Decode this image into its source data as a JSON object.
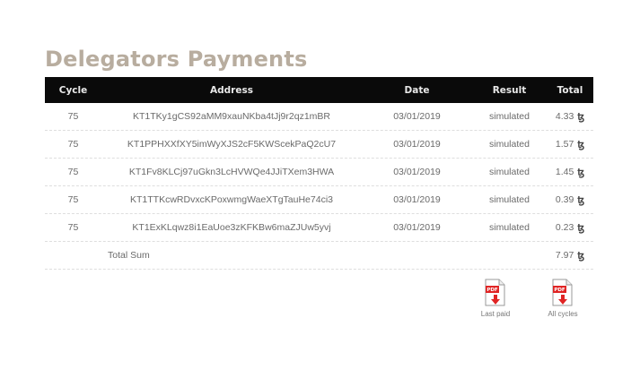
{
  "page": {
    "title": "Delegators Payments",
    "title_color": "#b8ad9f"
  },
  "table": {
    "headers": {
      "cycle": "Cycle",
      "address": "Address",
      "date": "Date",
      "result": "Result",
      "total": "Total"
    },
    "rows": [
      {
        "cycle": "75",
        "address": "KT1TKy1gCS92aMM9xauNKba4tJj9r2qz1mBR",
        "date": "03/01/2019",
        "result": "simulated",
        "total": "4.33",
        "currency": "ꜩ"
      },
      {
        "cycle": "75",
        "address": "KT1PPHXXfXY5imWyXJS2cF5KWScekPaQ2cU7",
        "date": "03/01/2019",
        "result": "simulated",
        "total": "1.57",
        "currency": "ꜩ"
      },
      {
        "cycle": "75",
        "address": "KT1Fv8KLCj97uGkn3LcHVWQe4JJiTXem3HWA",
        "date": "03/01/2019",
        "result": "simulated",
        "total": "1.45",
        "currency": "ꜩ"
      },
      {
        "cycle": "75",
        "address": "KT1TTKcwRDvxcKPoxwmgWaeXTgTauHe74ci3",
        "date": "03/01/2019",
        "result": "simulated",
        "total": "0.39",
        "currency": "ꜩ"
      },
      {
        "cycle": "75",
        "address": "KT1ExKLqwz8i1EaUoe3zKFKBw6maZJUw5yvj",
        "date": "03/01/2019",
        "result": "simulated",
        "total": "0.23",
        "currency": "ꜩ"
      }
    ],
    "sum": {
      "label": "Total Sum",
      "total": "7.97",
      "currency": "ꜩ"
    }
  },
  "downloads": {
    "last_paid": {
      "icon": "pdf-icon",
      "label": "Last paid",
      "badge": "PDF"
    },
    "all_cycles": {
      "icon": "pdf-icon",
      "label": "All cycles",
      "badge": "PDF"
    }
  },
  "colors": {
    "header_bg": "#0a0a0a",
    "header_text": "#e9e9e9",
    "pdf_red": "#e02424",
    "row_divider": "#dedede"
  }
}
